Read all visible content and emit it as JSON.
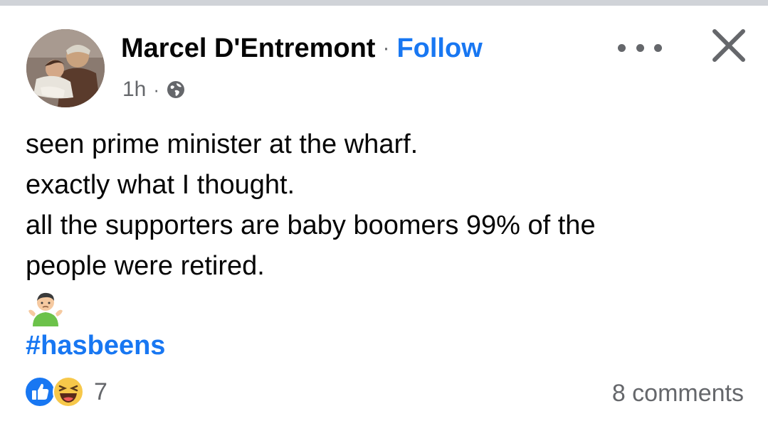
{
  "post": {
    "author": {
      "name": "Marcel D'Entremont",
      "separator": "·",
      "follow_label": "Follow"
    },
    "meta": {
      "time": "1h",
      "separator": "·",
      "audience_icon": "globe-icon"
    },
    "actions": {
      "more_icon": "more-options-icon",
      "close_icon": "close-icon"
    },
    "text_lines": [
      "seen prime minister at the wharf.",
      "exactly what I thought.",
      "all the supporters are baby boomers 99% of the",
      "people were retired."
    ],
    "emoji": "man-shrugging-emoji",
    "hashtag": "#hasbeens",
    "reactions": {
      "icons": [
        "like-icon",
        "haha-icon"
      ],
      "count": "7"
    },
    "comments_label": "8 comments"
  },
  "colors": {
    "link_blue": "#1877f2",
    "secondary_text": "#65676b",
    "primary_text": "#050505",
    "top_bar": "#d0d3d8"
  }
}
